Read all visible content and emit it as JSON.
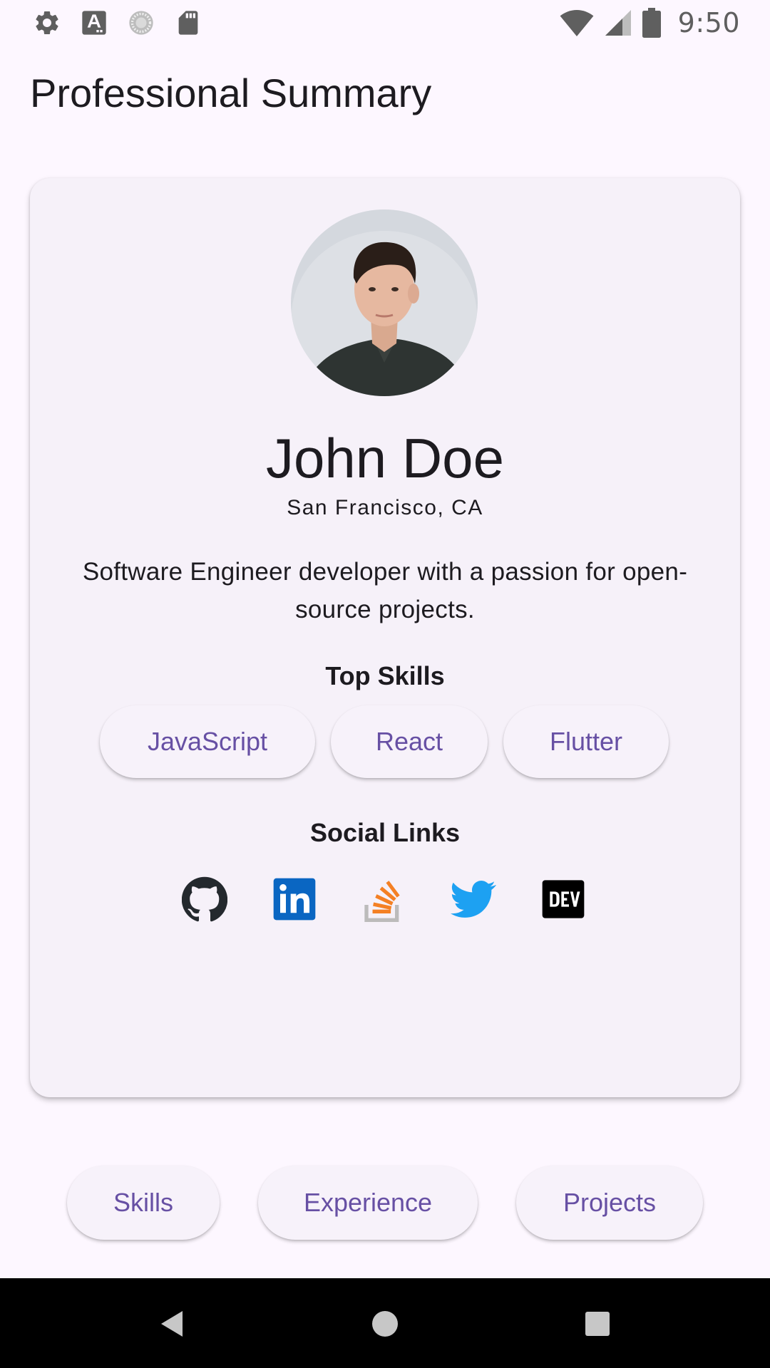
{
  "status_bar": {
    "time": "9:50",
    "left_icons": [
      "settings-icon",
      "font-a-icon",
      "sync-circle-icon",
      "sd-card-icon"
    ],
    "right_icons": [
      "wifi-icon",
      "cellular-signal-icon",
      "battery-icon"
    ]
  },
  "header": {
    "title": "Professional Summary"
  },
  "profile": {
    "name": "John Doe",
    "location": "San Francisco, CA",
    "bio": "Software Engineer developer with a passion for open-source projects.",
    "skills_heading": "Top Skills",
    "skills": [
      "JavaScript",
      "React",
      "Flutter"
    ],
    "social_heading": "Social Links",
    "social_links": [
      {
        "icon": "github-icon",
        "color": "#24292E"
      },
      {
        "icon": "linkedin-icon",
        "color": "#0A66C2"
      },
      {
        "icon": "stackoverflow-icon",
        "color": "#F48024"
      },
      {
        "icon": "twitter-icon",
        "color": "#1DA1F2"
      },
      {
        "icon": "devto-icon",
        "color": "#000000"
      }
    ]
  },
  "bottom_buttons": [
    "Skills",
    "Experience",
    "Projects"
  ],
  "nav_bar": {
    "icons": [
      "back-triangle-icon",
      "home-circle-icon",
      "recents-square-icon"
    ]
  },
  "colors": {
    "background": "#FDF7FF",
    "card": "#F6F1F9",
    "accent": "#6750A4",
    "text": "#1D1B20"
  }
}
